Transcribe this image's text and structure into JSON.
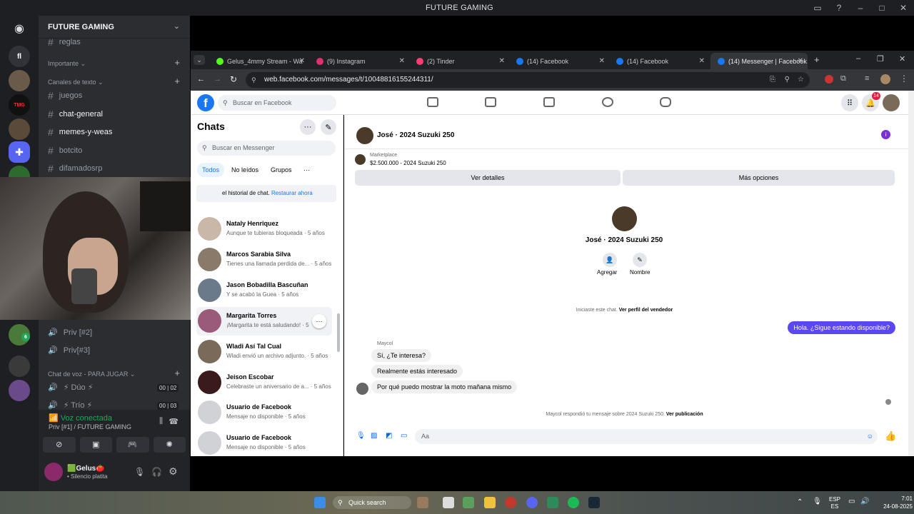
{
  "discord": {
    "window_title": "FUTURE GAMING",
    "server_name": "FUTURE GAMING",
    "rail_label_1": "fl",
    "rail_label_2": "TMG",
    "channel_partial": "reglas",
    "cat_importante": "Importante",
    "cat_texto": "Canales de texto",
    "channels": [
      "juegos",
      "chat-general",
      "memes-y-weas",
      "botcito",
      "difamadosrp"
    ],
    "priv2": "Priv [#2]",
    "priv3": "Priv[#3]",
    "cat_voz": "Chat de voz - PARA JUGAR",
    "duo": "⚡ Dúo ⚡",
    "trio": "⚡ Trío ⚡",
    "duo_count_a": "00",
    "duo_count_b": "02",
    "trio_count_a": "00",
    "trio_count_b": "03",
    "voice_status": "Voz conectada",
    "voice_channel": "Priv [#1] / FUTURE GAMING",
    "username": "🟩Gelus🍅",
    "user_status": "• Silencio platita",
    "badge_count": "6"
  },
  "browser": {
    "tabs": [
      {
        "label": "Gelus_4mmy Stream - Wa",
        "color": "#53fc18"
      },
      {
        "label": "(9) Instagram",
        "color": "#e1306c"
      },
      {
        "label": "(2) Tinder",
        "color": "#fe3c72"
      },
      {
        "label": "(14) Facebook",
        "color": "#1877f2"
      },
      {
        "label": "(14) Facebook",
        "color": "#1877f2"
      },
      {
        "label": "(14) Messenger | Facebook",
        "color": "#1877f2"
      }
    ],
    "url": "web.facebook.com/messages/t/10048816155244311/"
  },
  "facebook": {
    "search_placeholder": "Buscar en Facebook",
    "notif_count": "14",
    "chats_title": "Chats",
    "messenger_search": "Buscar en Messenger",
    "filters": [
      "Todos",
      "No leídos",
      "Grupos"
    ],
    "more_dots": "···",
    "history_notice": "el historial de chat.",
    "restore_link": "Restaurar ahora",
    "chats": [
      {
        "name": "Nataly Henriquez",
        "preview": "Aunque te tubieras bloqueada · 5 años",
        "color": "#c9b8a8"
      },
      {
        "name": "Marcos Sarabia Silva",
        "preview": "Tienes una llamada perdida de... · 5 años",
        "color": "#8a7a6a"
      },
      {
        "name": "Jason Bobadilla Bascuñan",
        "preview": "Y se acabó la Guea · 5 años",
        "color": "#6b7a8a"
      },
      {
        "name": "Margarita Torres",
        "preview": "¡Margarita te está saludando! · 5",
        "color": "#9a5a7a"
      },
      {
        "name": "Wladi Así Tal Cual",
        "preview": "Wladi envió un archivo adjunto. · 5 años",
        "color": "#7a6a5a"
      },
      {
        "name": "Jeison Escobar",
        "preview": "Celebraste un aniversario de a... · 5 años",
        "color": "#3a1a1a"
      },
      {
        "name": "Usuario de Facebook",
        "preview": "Mensaje no disponible · 5 años",
        "color": "#d0d2d6"
      },
      {
        "name": "Usuario de Facebook",
        "preview": "Mensaje no disponible · 5 años",
        "color": "#d0d2d6"
      }
    ],
    "convo_title": "José · 2024 Suzuki 250",
    "marketplace_label": "Marketplace",
    "listing": "$2.500.000 - 2024 Suzuki 250",
    "btn_details": "Ver detalles",
    "btn_more": "Más opciones",
    "profile_name": "José · 2024 Suzuki 250",
    "action_add": "Agregar",
    "action_name": "Nombre",
    "started_text": "Iniciaste este chat.",
    "seller_link": "Ver perfil del vendedor",
    "out_msg": "Hola. ¿Sigue estando disponible?",
    "sender": "Maycol",
    "in_msgs": [
      "Sí, ¿Te interesa?",
      "Realmente estás interesado",
      "Por qué puedo mostrar la moto mañana mismo"
    ],
    "reply_notice": "Maycol respondió tu mensaje sobre 2024 Suzuki 250.",
    "reply_link": "Ver publicación",
    "compose_placeholder": "Aa"
  },
  "taskbar": {
    "search": "Quick search",
    "lang_top": "ESP",
    "lang_bottom": "ES",
    "time": "7:01",
    "date": "24-08-2025"
  }
}
